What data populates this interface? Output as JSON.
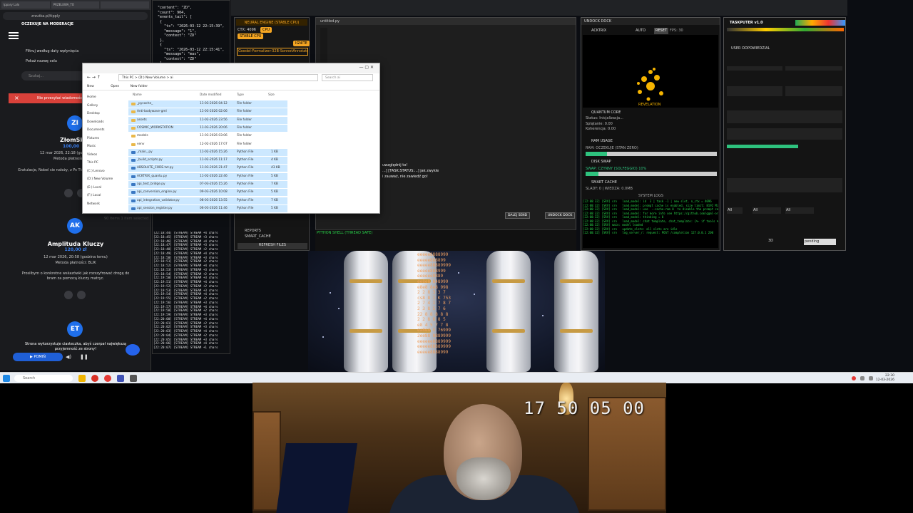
{
  "browser": {
    "tabs": [
      "Ippary Lalo",
      "PRZELEWA_TO",
      ""
    ],
    "url": "zrzutka.pl/tipply",
    "banner": "OCZEKUJE NA MODERACJE",
    "filter_label": "Filtruj według daty wpłynięcia",
    "show_goal_label": "Pokaż nazwę celu",
    "search_placeholder": "Szukaj...",
    "alert_text": "Nie przesyłać wiadomości",
    "donations": [
      {
        "initials": "ZI",
        "name": "ZłomSki",
        "amount": "100,00",
        "date": "12 mar 2026, 22:18 (godzina temu)",
        "method": "Metoda płatności",
        "message": "Gratulacje, Nobel sie należy, z Ps Tts padl"
      },
      {
        "initials": "AK",
        "name": "Amplituda Kluczy",
        "amount": "120,00 zł",
        "date": "12 mar 2026, 20:58 (godzina temu)",
        "method": "Metoda płatności: BLIK",
        "message": "Prosiłbym o konkretne wskazówki jak rozszyfrować drogę do bram za pomocą kluczy matryc."
      },
      {
        "initials": "ET",
        "name": "",
        "amount": "",
        "date": "",
        "method": "",
        "message": ""
      }
    ],
    "cookie_text": "Strona wykorzystuje ciasteczka, abyś czerpał największą przyjemność ze strony!",
    "skip_label": "POMIŃ"
  },
  "terminal": {
    "json_text": "  \"content\": \"ZD\",\n  \"count\": 904,\n  \"events_tail\": [\n   {\n     \"ts\": \"2026-03-12 22:15:39\",\n     \"message\": \"1\",\n     \"context\": \"ZD\"\n   },\n   {\n     \"ts\": \"2026-03-12 22:15:41\",\n     \"message\": \"mas\",\n     \"context\": \"ZD\"\n   }",
    "stream_log": "[22:18:44] [STREAM] STREAM +4 chars\n[22:18:45] [STREAM] STREAM +3 chars\n[22:18:46] [STREAM] STREAM +4 chars\n[22:18:47] [STREAM] STREAM +3 chars\n[22:18:48] [STREAM] STREAM +2 chars\n[22:18:49] [STREAM] STREAM +4 chars\n[22:18:50] [STREAM] STREAM +3 chars\n[22:18:51] [STREAM] STREAM +2 chars\n[22:18:52] [STREAM] STREAM +4 chars\n[22:18:53] [STREAM] STREAM +3 chars\n[22:18:54] [STREAM] STREAM +2 chars\n[22:19:50] [STREAM] STREAM +3 chars\n[22:19:51] [STREAM] STREAM +4 chars\n[22:19:52] [STREAM] STREAM +2 chars\n[22:19:53] [STREAM] STREAM +3 chars\n[22:19:54] [STREAM] STREAM +4 chars\n[22:19:55] [STREAM] STREAM +2 chars\n[22:19:56] [STREAM] STREAM +3 chars\n[22:19:57] [STREAM] STREAM +4 chars\n[22:19:58] [STREAM] STREAM +2 chars\n[22:19:59] [STREAM] STREAM +3 chars\n[22:20:00] [STREAM] STREAM +4 chars\n[22:20:01] [STREAM] STREAM +2 chars\n[22:20:02] [STREAM] STREAM +3 chars\n[22:20:03] [STREAM] STREAM +4 chars\n[22:20:04] [STREAM] STREAM +2 chars\n[22:20:05] [STREAM] STREAM +3 chars\n[22:20:06] [STREAM] STREAM +4 chars\n[22:20:07] [STREAM] STREAM +1 chars"
  },
  "neural": {
    "title": "NEURAL ENGINE (STABLE CPU)",
    "ctx_label": "CTX: 4096",
    "cpu_label": "CPU",
    "badge": "STABLE CPU",
    "ignite": "IGNITE",
    "model": "Goedel-Formalizer-32B-SonnetAnnotated",
    "reports": "REPORTS",
    "smart_cache": "SMART_CACHE",
    "refresh": "REFRESH FILES"
  },
  "editor": {
    "title": "untitled.py",
    "chat_lines": [
      "uwzględnij to!",
      "...] [TASK:STATUS:...] jak zwykle",
      "i zauważ, nie zawiedź go!"
    ],
    "send_label": "DALEJ SEND",
    "undock_label": "UNDOCK DOCK",
    "shell_label": "PYTHON SHELL (THREAD SAFE)"
  },
  "undock": {
    "title": "UNDOCK DOCK",
    "mode": "ACKTRIX",
    "auto": "AUTO",
    "reset": "RESET",
    "fps": "FPS: 30",
    "revelation": "REVELATION",
    "quantum_title": "QUANTUM CORE",
    "quantum_lines": [
      "Status: Inicjalizacja...",
      "Splątanie: 0.00",
      "Koherencja: 0.00"
    ],
    "ram_title": "RAM USAGE",
    "ram_sub": "RAM: OCZEKUJE (STAN ZERO)",
    "disk_title": "DISK SWAP",
    "swap_label": "SWAP: CZYNNY (SOLFEGGIO) 10%",
    "cache_title": "SMART CACHE",
    "cache_sub": "SLADY: 0 | WIEDZA: 0.0MB",
    "syslog_title": "SYSTEM LOGS",
    "syslog": "[22:00:32] [SRV] srv   load_model: id  3 | task -1 | new slot, n_ctx = 4096\n[22:00:32] [SRV] srv   load_model: prompt cache is enabled, size limit: 8192 MiB\n[22:00:32] [SRV] srv   load_model: use  --cache-ram 0  to disable the prompt cache\n[22:00:32] [SRV] srv   load_model: for more info see https://github.com/ggml-org\n[22:00:32] [SRV] srv   load_model: thinking = 0\n[22:00:32] [SRV] srv   load_model: chat template, chat_template: {%- if tools %}\n[22:00:32] [SRV] main: model loaded\n[22:00:32] [SRV] srv   update_slots: all slots are idle\n[22:00:32] [SRV] srv   log_server_r: request: POST /completion 127.0.0.1 200"
  },
  "taskputer": {
    "title": "TASKPUTER v1.0",
    "user": "USER ODPOWIEDZIAL",
    "filters": [
      "All",
      "All",
      "All"
    ],
    "bottom": [
      "3D",
      "pending"
    ]
  },
  "explorer": {
    "crumb": "This PC > (D:) New Volume > ai",
    "search_placeholder": "Search ai",
    "cmd_new": "New",
    "cmd_open": "Open",
    "cmd_folder": "New folder",
    "columns": [
      "Name",
      "Date modified",
      "Type",
      "Size"
    ],
    "nav": [
      "Home",
      "Gallery",
      "Desktop",
      "Downloads",
      "Documents",
      "Pictures",
      "Music",
      "Videos",
      "This PC",
      "(C:) Lenovo",
      "(D:) New Volume",
      "(E:) Local",
      "(F:) Local",
      "Network"
    ],
    "files": [
      {
        "name": "_pycache_",
        "date": "11-03-2026 04:12",
        "type": "File folder",
        "size": "",
        "folder": true,
        "sel": true
      },
      {
        "name": "Anti-bodywave-gml",
        "date": "11-03-2026 02:06",
        "type": "File folder",
        "size": "",
        "folder": true,
        "sel": true
      },
      {
        "name": "assets",
        "date": "11-02-2026 23:56",
        "type": "File folder",
        "size": "",
        "folder": true,
        "sel": true
      },
      {
        "name": "COSMIC_WORKSTATION",
        "date": "11-03-2026 20:06",
        "type": "File folder",
        "size": "",
        "folder": true,
        "sel": true
      },
      {
        "name": "models",
        "date": "11-03-2026 03:06",
        "type": "File folder",
        "size": "",
        "folder": true,
        "sel": false
      },
      {
        "name": "venv",
        "date": "12-02-2026 17:07",
        "type": "File folder",
        "size": "",
        "folder": true,
        "sel": false
      },
      {
        "name": "_main_.py",
        "date": "11-02-2026 15:26",
        "type": "Python File",
        "size": "1 KB",
        "folder": false,
        "sel": true
      },
      {
        "name": "_build_scripts.py",
        "date": "11-02-2026 11:17",
        "type": "Python File",
        "size": "4 KB",
        "folder": false,
        "sel": true
      },
      {
        "name": "ABSOLUTE_CODE.txt.py",
        "date": "11-03-2026 21:47",
        "type": "Python File",
        "size": "43 KB",
        "folder": false,
        "sel": true
      },
      {
        "name": "ACKTRIX_quantu.py",
        "date": "11-02-2026 22:46",
        "type": "Python File",
        "size": "5 KB",
        "folder": false,
        "sel": true
      },
      {
        "name": "api_test_bridge.py",
        "date": "07-03-2026 15:26",
        "type": "Python File",
        "size": "7 KB",
        "folder": false,
        "sel": true
      },
      {
        "name": "api_conversion_engine.py",
        "date": "09-03-2026 10:08",
        "type": "Python File",
        "size": "5 KB",
        "folder": false,
        "sel": true
      },
      {
        "name": "api_integration_validator.py",
        "date": "08-03-2026 13:55",
        "type": "Python File",
        "size": "7 KB",
        "folder": false,
        "sel": true
      },
      {
        "name": "api_session_register.py",
        "date": "06-03-2026 11:46",
        "type": "Python File",
        "size": "5 KB",
        "folder": false,
        "sel": true
      }
    ],
    "status": "90 items  1 item selected"
  },
  "code_rain": "eeeee8888999\neeeee888899\neeeee88889999\neeeee888999\neeeeee8889\nee8e8 848999\ne8e8 8e8 998\n2 2 8 3 3 7\ncs8 8 I K 753\n2 7 4 I 7 8 7\n2 3 8 5 7 6\n22 8 8 8 8 8\n2 2 8 8 8 5\ne8 4 5 7 7 8\nea8e4 V 76999\n2ee88 8889999\neeeeee8889999\neeeee88889999\neeeee8888999",
  "taskbar": {
    "search": "Search",
    "time": "22:30",
    "date": "12-03-2026"
  },
  "webcam": {
    "timecode": "17 50 05 00"
  },
  "colors": {
    "accent_blue": "#1f6feb",
    "alert_red": "#d9413a",
    "amber": "#f5a623",
    "log_green": "#29d34a",
    "quantum_gold": "#f5b400"
  }
}
